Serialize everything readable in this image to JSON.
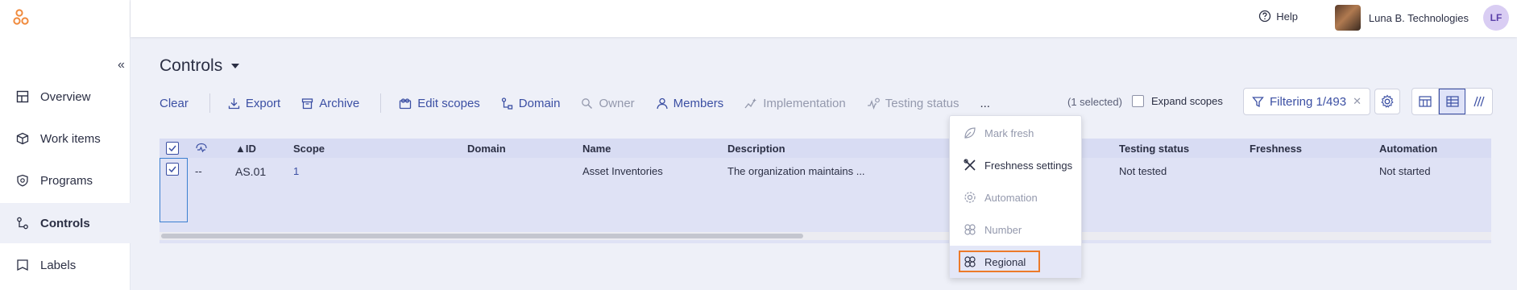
{
  "sidebar": {
    "collapse_glyph": "«",
    "items": [
      {
        "label": "Overview",
        "icon": "layout-icon"
      },
      {
        "label": "Work items",
        "icon": "box-icon"
      },
      {
        "label": "Programs",
        "icon": "shield-icon"
      },
      {
        "label": "Controls",
        "icon": "controls-icon",
        "active": true
      },
      {
        "label": "Labels",
        "icon": "label-icon"
      }
    ]
  },
  "topbar": {
    "help_label": "Help",
    "org_name": "Luna B. Technologies",
    "avatar_initials": "LF"
  },
  "page": {
    "title": "Controls"
  },
  "toolbar": {
    "clear": "Clear",
    "export": "Export",
    "archive": "Archive",
    "edit_scopes": "Edit scopes",
    "domain": "Domain",
    "owner": "Owner",
    "members": "Members",
    "implementation": "Implementation",
    "testing_status": "Testing status",
    "more": "...",
    "selected_count": "(1 selected)",
    "expand_scopes": "Expand scopes",
    "filtering": "Filtering 1/493",
    "filter_clear": "✕"
  },
  "table": {
    "headers": {
      "id": "▲ID",
      "scope": "Scope",
      "domain": "Domain",
      "name": "Name",
      "description": "Description",
      "testing_status": "Testing status",
      "freshness": "Freshness",
      "automation": "Automation"
    },
    "rows": [
      {
        "freshness_mark": "--",
        "id": "AS.01",
        "scope": "1",
        "domain": "",
        "name": "Asset Inventories",
        "description": "The organization maintains ...",
        "testing_status": "Not tested",
        "freshness": "",
        "automation": "Not started"
      }
    ]
  },
  "menu": {
    "items": [
      {
        "label": "Mark fresh",
        "enabled": false
      },
      {
        "label": "Freshness settings",
        "enabled": true
      },
      {
        "label": "Automation",
        "enabled": false
      },
      {
        "label": "Number",
        "enabled": false
      },
      {
        "label": "Regional",
        "enabled": true,
        "hover": true
      }
    ]
  },
  "colors": {
    "accent": "#3b4fa3",
    "brand_orange": "#f08a3c",
    "highlight": "#ec7a2a"
  }
}
